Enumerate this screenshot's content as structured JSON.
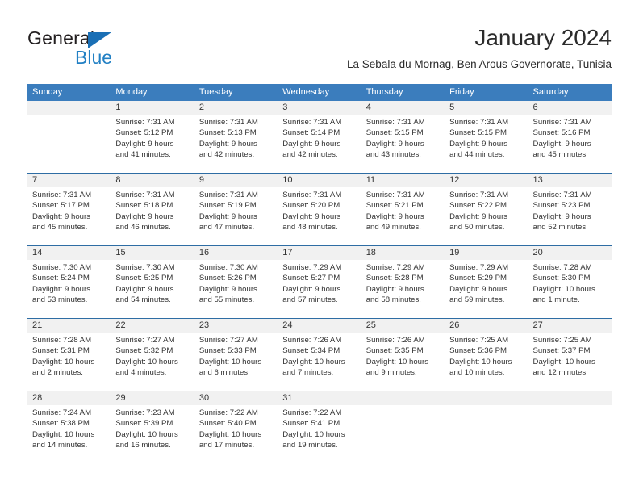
{
  "brand": {
    "name_part1": "General",
    "name_part2": "Blue",
    "accent_color": "#2280c4",
    "flag_color": "#1a6fb5"
  },
  "header": {
    "title": "January 2024",
    "subtitle": "La Sebala du Mornag, Ben Arous Governorate, Tunisia"
  },
  "calendar": {
    "header_bg": "#3b7dbd",
    "daynum_bg": "#f1f1f1",
    "separator_color": "#2e6da4",
    "weekdays": [
      "Sunday",
      "Monday",
      "Tuesday",
      "Wednesday",
      "Thursday",
      "Friday",
      "Saturday"
    ],
    "weeks": [
      [
        {
          "day": "",
          "lines": []
        },
        {
          "day": "1",
          "lines": [
            "Sunrise: 7:31 AM",
            "Sunset: 5:12 PM",
            "Daylight: 9 hours",
            "and 41 minutes."
          ]
        },
        {
          "day": "2",
          "lines": [
            "Sunrise: 7:31 AM",
            "Sunset: 5:13 PM",
            "Daylight: 9 hours",
            "and 42 minutes."
          ]
        },
        {
          "day": "3",
          "lines": [
            "Sunrise: 7:31 AM",
            "Sunset: 5:14 PM",
            "Daylight: 9 hours",
            "and 42 minutes."
          ]
        },
        {
          "day": "4",
          "lines": [
            "Sunrise: 7:31 AM",
            "Sunset: 5:15 PM",
            "Daylight: 9 hours",
            "and 43 minutes."
          ]
        },
        {
          "day": "5",
          "lines": [
            "Sunrise: 7:31 AM",
            "Sunset: 5:15 PM",
            "Daylight: 9 hours",
            "and 44 minutes."
          ]
        },
        {
          "day": "6",
          "lines": [
            "Sunrise: 7:31 AM",
            "Sunset: 5:16 PM",
            "Daylight: 9 hours",
            "and 45 minutes."
          ]
        }
      ],
      [
        {
          "day": "7",
          "lines": [
            "Sunrise: 7:31 AM",
            "Sunset: 5:17 PM",
            "Daylight: 9 hours",
            "and 45 minutes."
          ]
        },
        {
          "day": "8",
          "lines": [
            "Sunrise: 7:31 AM",
            "Sunset: 5:18 PM",
            "Daylight: 9 hours",
            "and 46 minutes."
          ]
        },
        {
          "day": "9",
          "lines": [
            "Sunrise: 7:31 AM",
            "Sunset: 5:19 PM",
            "Daylight: 9 hours",
            "and 47 minutes."
          ]
        },
        {
          "day": "10",
          "lines": [
            "Sunrise: 7:31 AM",
            "Sunset: 5:20 PM",
            "Daylight: 9 hours",
            "and 48 minutes."
          ]
        },
        {
          "day": "11",
          "lines": [
            "Sunrise: 7:31 AM",
            "Sunset: 5:21 PM",
            "Daylight: 9 hours",
            "and 49 minutes."
          ]
        },
        {
          "day": "12",
          "lines": [
            "Sunrise: 7:31 AM",
            "Sunset: 5:22 PM",
            "Daylight: 9 hours",
            "and 50 minutes."
          ]
        },
        {
          "day": "13",
          "lines": [
            "Sunrise: 7:31 AM",
            "Sunset: 5:23 PM",
            "Daylight: 9 hours",
            "and 52 minutes."
          ]
        }
      ],
      [
        {
          "day": "14",
          "lines": [
            "Sunrise: 7:30 AM",
            "Sunset: 5:24 PM",
            "Daylight: 9 hours",
            "and 53 minutes."
          ]
        },
        {
          "day": "15",
          "lines": [
            "Sunrise: 7:30 AM",
            "Sunset: 5:25 PM",
            "Daylight: 9 hours",
            "and 54 minutes."
          ]
        },
        {
          "day": "16",
          "lines": [
            "Sunrise: 7:30 AM",
            "Sunset: 5:26 PM",
            "Daylight: 9 hours",
            "and 55 minutes."
          ]
        },
        {
          "day": "17",
          "lines": [
            "Sunrise: 7:29 AM",
            "Sunset: 5:27 PM",
            "Daylight: 9 hours",
            "and 57 minutes."
          ]
        },
        {
          "day": "18",
          "lines": [
            "Sunrise: 7:29 AM",
            "Sunset: 5:28 PM",
            "Daylight: 9 hours",
            "and 58 minutes."
          ]
        },
        {
          "day": "19",
          "lines": [
            "Sunrise: 7:29 AM",
            "Sunset: 5:29 PM",
            "Daylight: 9 hours",
            "and 59 minutes."
          ]
        },
        {
          "day": "20",
          "lines": [
            "Sunrise: 7:28 AM",
            "Sunset: 5:30 PM",
            "Daylight: 10 hours",
            "and 1 minute."
          ]
        }
      ],
      [
        {
          "day": "21",
          "lines": [
            "Sunrise: 7:28 AM",
            "Sunset: 5:31 PM",
            "Daylight: 10 hours",
            "and 2 minutes."
          ]
        },
        {
          "day": "22",
          "lines": [
            "Sunrise: 7:27 AM",
            "Sunset: 5:32 PM",
            "Daylight: 10 hours",
            "and 4 minutes."
          ]
        },
        {
          "day": "23",
          "lines": [
            "Sunrise: 7:27 AM",
            "Sunset: 5:33 PM",
            "Daylight: 10 hours",
            "and 6 minutes."
          ]
        },
        {
          "day": "24",
          "lines": [
            "Sunrise: 7:26 AM",
            "Sunset: 5:34 PM",
            "Daylight: 10 hours",
            "and 7 minutes."
          ]
        },
        {
          "day": "25",
          "lines": [
            "Sunrise: 7:26 AM",
            "Sunset: 5:35 PM",
            "Daylight: 10 hours",
            "and 9 minutes."
          ]
        },
        {
          "day": "26",
          "lines": [
            "Sunrise: 7:25 AM",
            "Sunset: 5:36 PM",
            "Daylight: 10 hours",
            "and 10 minutes."
          ]
        },
        {
          "day": "27",
          "lines": [
            "Sunrise: 7:25 AM",
            "Sunset: 5:37 PM",
            "Daylight: 10 hours",
            "and 12 minutes."
          ]
        }
      ],
      [
        {
          "day": "28",
          "lines": [
            "Sunrise: 7:24 AM",
            "Sunset: 5:38 PM",
            "Daylight: 10 hours",
            "and 14 minutes."
          ]
        },
        {
          "day": "29",
          "lines": [
            "Sunrise: 7:23 AM",
            "Sunset: 5:39 PM",
            "Daylight: 10 hours",
            "and 16 minutes."
          ]
        },
        {
          "day": "30",
          "lines": [
            "Sunrise: 7:22 AM",
            "Sunset: 5:40 PM",
            "Daylight: 10 hours",
            "and 17 minutes."
          ]
        },
        {
          "day": "31",
          "lines": [
            "Sunrise: 7:22 AM",
            "Sunset: 5:41 PM",
            "Daylight: 10 hours",
            "and 19 minutes."
          ]
        },
        {
          "day": "",
          "lines": []
        },
        {
          "day": "",
          "lines": []
        },
        {
          "day": "",
          "lines": []
        }
      ]
    ]
  }
}
